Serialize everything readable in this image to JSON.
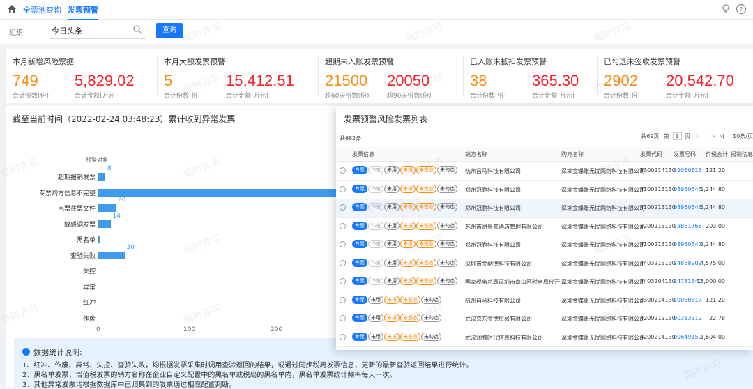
{
  "nav": {
    "tabs": [
      "全票池查询",
      "发票预警"
    ]
  },
  "filter": {
    "org_label": "组织",
    "org_value": "今日头条",
    "query_button": "查询"
  },
  "stats": [
    {
      "title": "本月新增风险票据",
      "v1": "749",
      "v2": "5,829.02",
      "s1": "合计份数(份)",
      "s2": "合计金额(万元)"
    },
    {
      "title": "本月大额发票预警",
      "v1": "5",
      "v2": "15,412.51",
      "s1": "合计份数(份)",
      "s2": "合计金额(万元)"
    },
    {
      "title": "超期未入账发票预警",
      "v1": "21500",
      "v2": "20050",
      "s1": "超60天份数(份)",
      "s2": "超90天份数(份)"
    },
    {
      "title": "已入账未抵扣发票预警",
      "v1": "38",
      "v2": "365.30",
      "s1": "合计份数(份)",
      "s2": "合计金额(万元)"
    },
    {
      "title": "已勾选未签收发票预警",
      "v1": "2902",
      "v2": "20,542.70",
      "s1": "合计份数(份)",
      "s2": "合计金额(万元)"
    }
  ],
  "panel": {
    "title": "截至当前时间（2022-02-24 03:48:23）累计收到异常发票"
  },
  "chart_data": {
    "type": "bar",
    "orientation": "horizontal",
    "ylabel": "预警对象",
    "categories": [
      "超期报销发票",
      "专票购方信息不完整",
      "电票往票文件",
      "敏感词发票",
      "黑名单",
      "查验失败",
      "失控",
      "异常",
      "红冲",
      "作废"
    ],
    "values": [
      8,
      300,
      20,
      14,
      2,
      30,
      0,
      0,
      0,
      0
    ],
    "data_labels": [
      "8",
      "",
      "20",
      "14",
      "",
      "30",
      "",
      "",
      "",
      ""
    ],
    "x_ticks": [
      "0",
      "100",
      "200"
    ],
    "xlim": [
      0,
      300
    ]
  },
  "note": {
    "title": "数据统计说明:",
    "lines": [
      "1、红冲、作废、异常、失控、查验失败，均根据发票采集时调用查验返回的结果，或通过同步税局发票信息，更新的最新查验返回结果进行统计。",
      "2、黑名单发票，增值税发票的销方名称在企业自定义配置中的黑名单或税局的黑名单内，黑名单发票统计频率每天一次。",
      "3、其他异常发票均根据数据库中已归集到的发票通过相应配置判断。"
    ]
  },
  "modal": {
    "title": "发票预警风险发票列表",
    "total": "共682条",
    "pager": {
      "pages": "共69页",
      "prefix": "第",
      "page": "1",
      "suffix": "页",
      "page_size": "10条/页"
    },
    "columns": [
      "发票信息",
      "销方名称",
      "购方名称",
      "发票代码",
      "发票号码",
      "价税合计",
      "报销信息"
    ],
    "rows": [
      {
        "tags": [
          "专票",
          "作废",
          "未用",
          "未报",
          "未签收",
          "未勾选"
        ],
        "seller": "杭州昌马科技有限公司",
        "buyer": "深圳金蝶账无忧网络科技有限公司",
        "code": "3300214130",
        "no": "29060616",
        "amount": "121.20",
        "hl": false
      },
      {
        "tags": [
          "专票",
          "作废",
          "未用",
          "未报",
          "未签收",
          "未勾选"
        ],
        "seller": "郑州冠鹏科技有限公司",
        "buyer": "深圳金蝶账无忧网络科技有限公司",
        "code": "4100213130",
        "no": "08950545",
        "amount": "1,244.80",
        "hl": false
      },
      {
        "tags": [
          "专票",
          "作废",
          "未用",
          "未报",
          "未签收",
          "未勾选"
        ],
        "seller": "郑州冠鹏科技有限公司",
        "buyer": "深圳金蝶账无忧网络科技有限公司",
        "code": "4100213130",
        "no": "08950546",
        "amount": "1,244.80",
        "hl": true
      },
      {
        "tags": [
          "专票",
          "作废",
          "未用",
          "未报",
          "未签收",
          "未勾选"
        ],
        "seller": "苏州市财景来酒店管理有限公司",
        "buyer": "深圳金蝶账无忧网络科技有限公司",
        "code": "3200213130",
        "no": "23861768",
        "amount": "203.00",
        "hl": false
      },
      {
        "tags": [
          "专票",
          "作废",
          "未用",
          "未报",
          "未签收",
          "未勾选"
        ],
        "seller": "郑州冠鹏科技有限公司",
        "buyer": "深圳金蝶账无忧网络科技有限公司",
        "code": "4100213130",
        "no": "08950547",
        "amount": "1,244.80",
        "hl": false
      },
      {
        "tags": [
          "专票",
          "作废",
          "未用",
          "未报",
          "未签收",
          "未勾选"
        ],
        "seller": "深圳市金纳德科技有限公司",
        "buyer": "深圳金蝶账无忧网络科技有限公司",
        "code": "4403213130",
        "no": "24868909",
        "amount": "4,575.00",
        "hl": false
      },
      {
        "tags": [
          "专票",
          "作废",
          "未用",
          "未报",
          "未签收",
          "未勾选"
        ],
        "seller": "国家税务总局深圳市南山区税务局代开...",
        "buyer": "深圳金蝶账无忧网络科技有限公司",
        "code": "4403204130",
        "no": "24781340",
        "amount": "15,000.00",
        "hl": false
      },
      {
        "tags": [
          "专票",
          "未用",
          "未报",
          "未签收",
          "未勾选"
        ],
        "seller": "杭州昌马科技有限公司",
        "buyer": "深圳金蝶账无忧网络科技有限公司",
        "code": "3300214130",
        "no": "29060617",
        "amount": "121.20",
        "hl": false
      },
      {
        "tags": [
          "专票",
          "未用",
          "未报",
          "未签收",
          "未勾选"
        ],
        "seller": "武汉京东金德贸易有限公司",
        "buyer": "深圳金蝶账无忧网络科技有限公司",
        "code": "4200212130",
        "no": "00313312",
        "amount": "22.78",
        "hl": false
      },
      {
        "tags": [
          "专票",
          "未用",
          "未报",
          "未签收",
          "未勾选"
        ],
        "seller": "武汉润腾时代信息科技有限公司",
        "buyer": "深圳金蝶账无忧网络科技有限公司",
        "code": "4200214130",
        "no": "00649159",
        "amount": "1,604.00",
        "hl": false
      }
    ]
  },
  "watermark": "临时许可"
}
